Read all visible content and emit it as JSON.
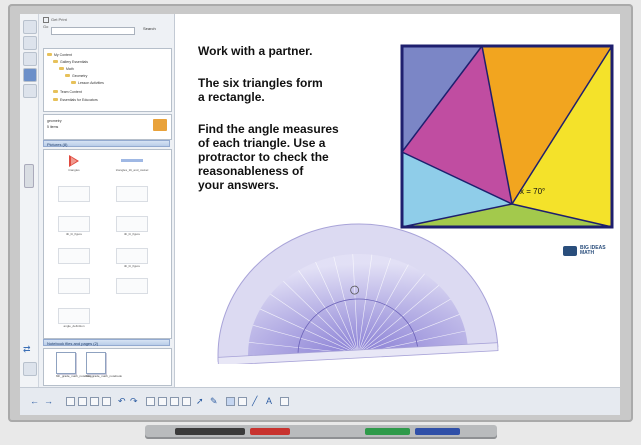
{
  "gallery": {
    "checkbox_label": "Get Print",
    "search_label": "Go",
    "search_button": "Search",
    "tree_items": [
      "My Content",
      "Gallery Essentials",
      "Math",
      "Geometry",
      "Lesson Activities",
      "Team Content",
      "Essentials for Educators"
    ],
    "detail_lines": [
      "geometry",
      "5 items"
    ],
    "pictures_header": "Pictures (8)",
    "picture_items": [
      "triangles",
      "triangles_tilt_and_swivel",
      "",
      "",
      "tilt_lit_figure",
      "tilt_lit_figure",
      "",
      "tilt_lit_figure",
      "",
      "",
      "",
      "angle_definition"
    ],
    "notebook_header": "Notebook files and pages (2)",
    "notebook_items": [
      "6th_grade_math_notebook",
      "6th_grade_math_notebook"
    ]
  },
  "page": {
    "line1": "Work with a partner.",
    "line2": "The six triangles form",
    "line3": "a rectangle.",
    "line4": "Find the angle measures",
    "line5": "of each triangle. Use a",
    "line6": "protractor to check the",
    "line7": "reasonableness of",
    "line8": "your answers.",
    "x_label": "x = 70°",
    "logo_line1": "BIG IDEAS",
    "logo_line2": "MATH"
  },
  "colors": {
    "blue": "#7b86c6",
    "magenta": "#c04da1",
    "orange": "#f2a51f",
    "yellow": "#f4e22a",
    "lightblue": "#8fcde9",
    "green": "#a3c94c",
    "border": "#1e1f6e",
    "protractor": "#a8a3d8"
  },
  "icons": [
    "undo-arrow-icon",
    "redo-arrow-icon",
    "pen-icon",
    "select-icon",
    "eraser-icon",
    "shape-icon",
    "text-icon",
    "table-icon"
  ]
}
